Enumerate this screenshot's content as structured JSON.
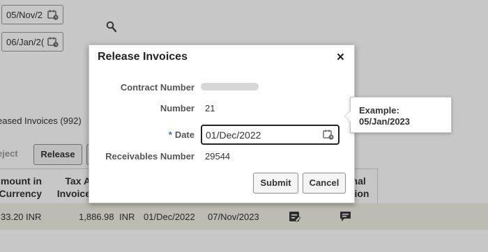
{
  "page": {
    "date_from": "05/Nov/2",
    "date_to": "06/Jan/2(",
    "released_invoices": "eased Invoices (992)",
    "toolbar": {
      "reject_label": "eject",
      "release_label": "Release"
    },
    "table": {
      "headers": {
        "amount": [
          "mount in",
          "Currency"
        ],
        "tax": [
          "Tax A",
          "Invoice"
        ],
        "additional": [
          "onal",
          "ation"
        ]
      },
      "row": {
        "amount": "33.20",
        "amount_currency": "INR",
        "tax": "1,886.98",
        "tax_currency": "INR",
        "date1": "01/Dec/2022",
        "date2": "07/Nov/2023"
      }
    }
  },
  "dialog": {
    "title": "Release Invoices",
    "close_label": "×",
    "fields": {
      "contract_number_label": "Contract Number",
      "number_label": "Number",
      "number_value": "21",
      "date_required": "*",
      "date_label": "Date",
      "date_value": "01/Dec/2022",
      "receivables_label": "Receivables Number",
      "receivables_value": "29544"
    },
    "buttons": {
      "submit": "Submit",
      "cancel": "Cancel"
    }
  },
  "tooltip": {
    "line1": "Example:",
    "line2": "05/Jan/2023"
  },
  "colors": {
    "required": "#2a6fc9",
    "row_highlight": "#f3f1e6"
  },
  "icons": [
    "calendar-icon",
    "search-icon",
    "close-icon",
    "edit-row-icon",
    "comment-row-icon"
  ]
}
